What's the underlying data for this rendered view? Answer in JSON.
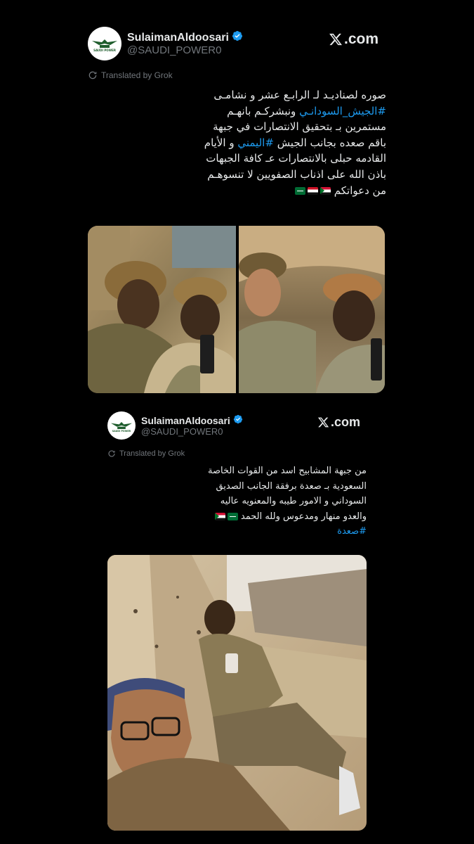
{
  "tweet1": {
    "author_name": "SulaimanAldoosari",
    "handle": "@SAUDI_POWER0",
    "brand": ".com",
    "translated_label": "Translated by Grok",
    "lines": [
      "صوره لصناديـد لـ الرابـع عشر و نشامـى",
      "ونبشركـم بانهـم",
      "مستمرين بـ بتحقيق الانتصارات في جبهة",
      "باقم صعده بجانب الجيش",
      "و الأيام",
      "القادمه حبلى بالانتصارات عـ كافة الجبهات",
      "باذن الله على اذناب الصفويين لا تنسوهـم",
      "من دعواتكم"
    ],
    "hashtag_sudan_army": "#الجيش_السودانـي",
    "hashtag_yemeni": "#اليمني",
    "photos": [
      "photo-selfie-two-soldiers-left",
      "photo-selfie-two-soldiers-right"
    ]
  },
  "tweet2": {
    "author_name": "SulaimanAldoosari",
    "handle": "@SAUDI_POWER0",
    "brand": ".com",
    "translated_label": "Translated by Grok",
    "lines": [
      "من جبهة المشابيح اسد من القوات الخاصة",
      "السعودية بـ صعدة برفقة الجانب الصديق",
      "السوداني و الامور طيبه والمعنويه عاليه",
      "والعدو منهار ومدعوس ولله الحمد"
    ],
    "hashtag_saada": "#صعدة",
    "photo": "photo-soldiers-in-ruins"
  },
  "colors": {
    "background": "#000000",
    "text": "#e7e9ea",
    "secondary": "#71767b",
    "link": "#1d9bf0",
    "verified": "#1d9bf0"
  },
  "icons": [
    "verified-icon",
    "x-logo-icon",
    "translate-icon",
    "saudi-power-logo",
    "saudi-flag-icon",
    "egypt-flag-icon",
    "sudan-flag-icon"
  ]
}
